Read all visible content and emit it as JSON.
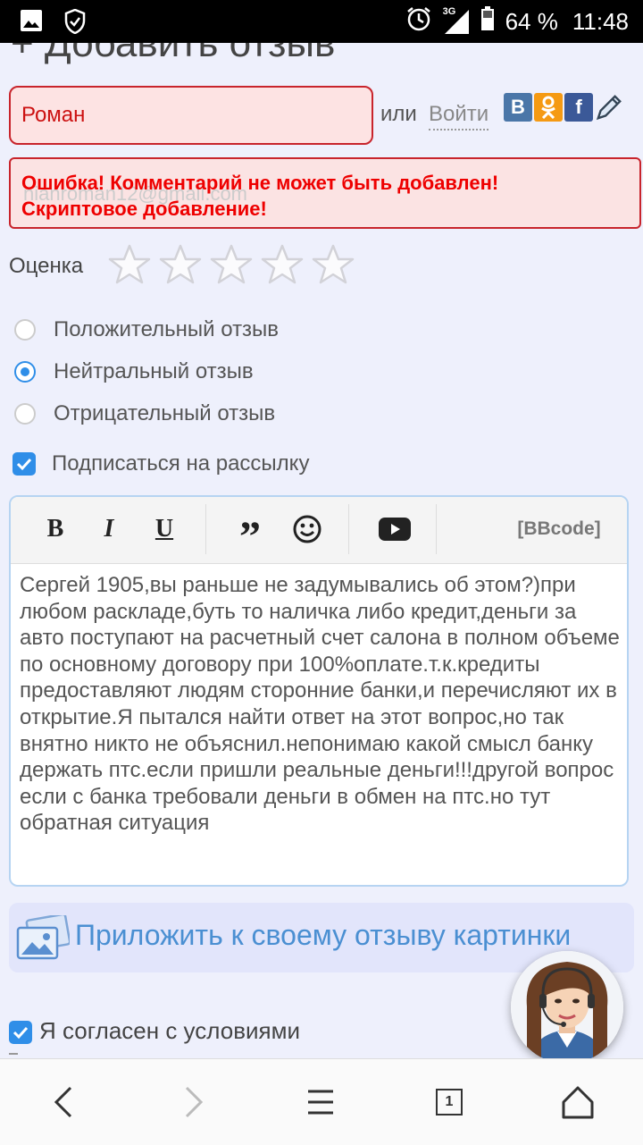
{
  "status_bar": {
    "battery": "64 %",
    "time": "11:48",
    "network": "3G"
  },
  "form": {
    "heading": "+ Добавить отзыв",
    "name_value": "Роман",
    "or_text": "или",
    "login_link": "Войти",
    "email_ghost": "nianroman12@gmail.com",
    "error_line1": "Ошибка! Комментарий не может быть добавлен!",
    "error_line2": "Скриптовое добавление!",
    "rating_label": "Оценка",
    "rating_value": 0,
    "rating_max": 5,
    "review_types": [
      {
        "label": "Положительный отзыв",
        "checked": false
      },
      {
        "label": "Нейтральный отзыв",
        "checked": true
      },
      {
        "label": "Отрицательный отзыв",
        "checked": false
      }
    ],
    "subscribe_label": "Подписаться на рассылку",
    "subscribe_checked": true
  },
  "editor": {
    "toolbar": {
      "bold": "B",
      "italic": "I",
      "underline": "U",
      "quote": "”",
      "bbcode": "[BBcode]"
    },
    "text": "Сергей 1905,вы раньше не задумывались об этом?)при любом раскладе,буть то наличка либо кредит,деньги за авто поступают на расчетный счет салона в полном объеме по основному договору при 100%оплате.т.к.кредиты предоставляют людям сторонние банки,и перечисляют их в открытие.Я пытался найти ответ на этот вопрос,но так внятно никто не объяснил.непонимаю какой смысл банку держать птс.если пришли реальные деньги!!!другой вопрос если с банка требовали деньги в обмен на птс.но тут обратная ситуация"
  },
  "attach": {
    "label": "Приложить к своему отзыву картинки"
  },
  "agree": {
    "label": "Я согласен с условиями",
    "checked": true
  },
  "browser_nav": {
    "tab_count": "1"
  },
  "colors": {
    "accent": "#2f8ee8",
    "error": "#e00000",
    "link": "#4a8fd2",
    "background": "#eef0fc"
  }
}
